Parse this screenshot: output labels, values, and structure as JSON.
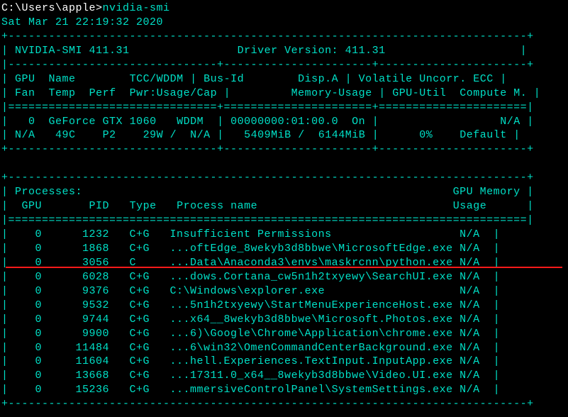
{
  "prompt": {
    "path": "C:\\Users\\apple>",
    "command": "nvidia-smi"
  },
  "timestamp": "Sat Mar 21 22:19:32 2020",
  "smi_version_label": "NVIDIA-SMI",
  "smi_version": "411.31",
  "driver_label": "Driver Version:",
  "driver_version": "411.31",
  "hdr": {
    "gpu": "GPU",
    "name": "Name",
    "fan": "Fan",
    "temp": "Temp",
    "perf": "Perf",
    "pwr": "Pwr:Usage/Cap",
    "tcc": "TCC/WDDM",
    "busid": "Bus-Id",
    "dispa": "Disp.A",
    "memuse": "Memory-Usage",
    "volatile": "Volatile",
    "uncorr": "Uncorr. ECC",
    "gpuutil": "GPU-Util",
    "computem": "Compute M."
  },
  "gpu0": {
    "idx": "0",
    "name": "GeForce GTX 1060",
    "tcc": "WDDM",
    "fan": "N/A",
    "temp": "49C",
    "perf": "P2",
    "pwr_used": "29W",
    "pwr_cap": "N/A",
    "busid": "00000000:01:00.0",
    "dispa": "On",
    "mem_used": "5409MiB",
    "mem_total": "6144MiB",
    "util": "0%",
    "ecc": "N/A",
    "compute": "Default"
  },
  "proc": {
    "title": "Processes:",
    "gpu": "GPU",
    "pid": "PID",
    "type": "Type",
    "name": "Process name",
    "memcol": "GPU Memory",
    "usage": "Usage"
  },
  "rows": [
    {
      "gpu": "0",
      "pid": "1232",
      "type": "C+G",
      "name": "Insufficient Permissions",
      "mem": "N/A"
    },
    {
      "gpu": "0",
      "pid": "1868",
      "type": "C+G",
      "name": "...oftEdge_8wekyb3d8bbwe\\MicrosoftEdge.exe",
      "mem": "N/A"
    },
    {
      "gpu": "0",
      "pid": "3056",
      "type": "C  ",
      "name": "...Data\\Anaconda3\\envs\\maskrcnn\\python.exe",
      "mem": "N/A"
    },
    {
      "gpu": "0",
      "pid": "6028",
      "type": "C+G",
      "name": "...dows.Cortana_cw5n1h2txyewy\\SearchUI.exe",
      "mem": "N/A"
    },
    {
      "gpu": "0",
      "pid": "9376",
      "type": "C+G",
      "name": "C:\\Windows\\explorer.exe",
      "mem": "N/A"
    },
    {
      "gpu": "0",
      "pid": "9532",
      "type": "C+G",
      "name": "...5n1h2txyewy\\StartMenuExperienceHost.exe",
      "mem": "N/A"
    },
    {
      "gpu": "0",
      "pid": "9744",
      "type": "C+G",
      "name": "...x64__8wekyb3d8bbwe\\Microsoft.Photos.exe",
      "mem": "N/A"
    },
    {
      "gpu": "0",
      "pid": "9900",
      "type": "C+G",
      "name": "...6)\\Google\\Chrome\\Application\\chrome.exe",
      "mem": "N/A"
    },
    {
      "gpu": "0",
      "pid": "11484",
      "type": "C+G",
      "name": "...6\\win32\\OmenCommandCenterBackground.exe",
      "mem": "N/A"
    },
    {
      "gpu": "0",
      "pid": "11604",
      "type": "C+G",
      "name": "...hell.Experiences.TextInput.InputApp.exe",
      "mem": "N/A"
    },
    {
      "gpu": "0",
      "pid": "13668",
      "type": "C+G",
      "name": "...17311.0_x64__8wekyb3d8bbwe\\Video.UI.exe",
      "mem": "N/A"
    },
    {
      "gpu": "0",
      "pid": "15236",
      "type": "C+G",
      "name": "...mmersiveControlPanel\\SystemSettings.exe",
      "mem": "N/A"
    }
  ]
}
